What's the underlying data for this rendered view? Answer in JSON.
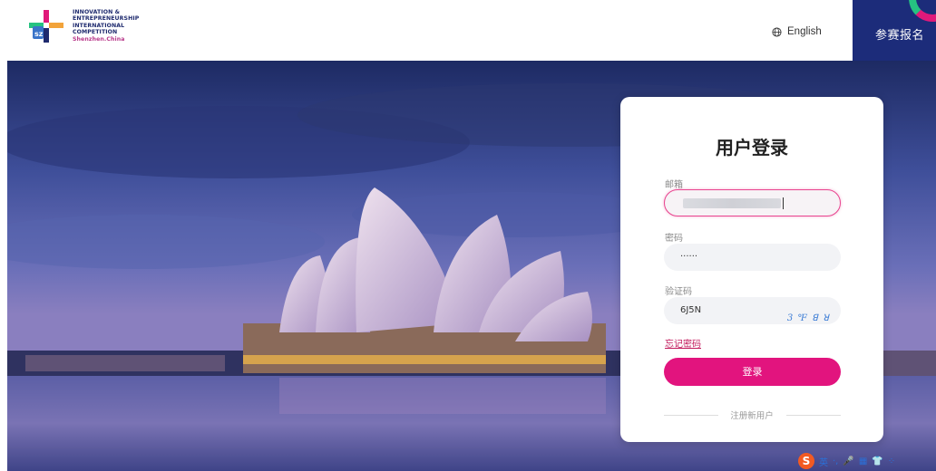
{
  "header": {
    "logo_lines": [
      "INNOVATION &",
      "ENTREPRENEURSHIP",
      "INTERNATIONAL",
      "COMPETITION",
      "Shenzhen.China"
    ],
    "language_label": "English",
    "register_label": "参赛报名"
  },
  "login": {
    "title": "用户登录",
    "email_label": "邮箱",
    "email_value": "",
    "password_label": "密码",
    "password_value": "······",
    "captcha_label": "验证码",
    "captcha_value": "6J5N",
    "captcha_image_text": "3 ℉ ꓭ ꓤ",
    "forgot_label": "忘记密码",
    "login_button": "登录",
    "register_link": "注册新用户"
  },
  "ime": {
    "logo": "S",
    "mode": "英",
    "items": [
      "·,",
      "🎤",
      "▦",
      "👕",
      "⁘"
    ]
  },
  "colors": {
    "accent": "#e2147e",
    "navy": "#1c2c7a",
    "card_bg": "#ffffff"
  }
}
